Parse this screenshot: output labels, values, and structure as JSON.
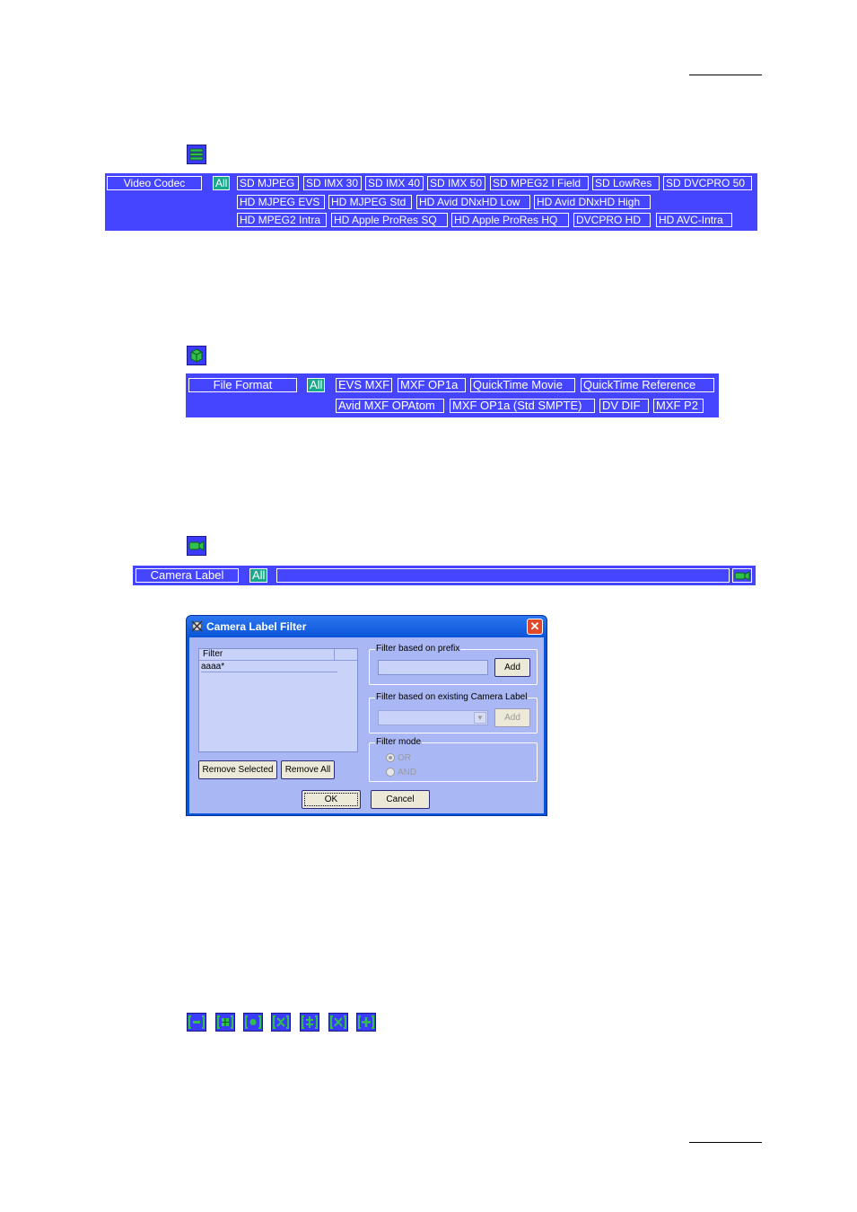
{
  "video_codec": {
    "label": "Video Codec",
    "options": [
      "All",
      "SD MJPEG",
      "SD IMX 30",
      "SD IMX 40",
      "SD IMX 50",
      "SD MPEG2 I Field",
      "SD LowRes",
      "SD DVCPRO 50",
      "HD MJPEG EVS",
      "HD MJPEG Std",
      "HD Avid DNxHD Low",
      "HD Avid DNxHD High",
      "HD MPEG2 Intra",
      "HD Apple ProRes SQ",
      "HD Apple ProRes HQ",
      "DVCPRO HD",
      "HD AVC-Intra"
    ]
  },
  "file_format": {
    "label": "File Format",
    "options": [
      "All",
      "EVS MXF",
      "MXF OP1a",
      "QuickTime Movie",
      "QuickTime Reference",
      "Avid MXF OPAtom",
      "MXF OP1a (Std SMPTE)",
      "DV DIF",
      "MXF P2"
    ]
  },
  "camera_label": {
    "label": "Camera Label",
    "all": "All",
    "field_value": ""
  },
  "dialog": {
    "title": "Camera Label Filter",
    "close": "✕",
    "list_header": "Filter",
    "list_items": [
      "aaaa*"
    ],
    "remove_selected": "Remove Selected",
    "remove_all": "Remove All",
    "prefix_group": "Filter based on prefix",
    "prefix_value": "",
    "add": "Add",
    "existing_group": "Filter based on existing Camera Label",
    "existing_value": "",
    "add_disabled": "Add",
    "mode_group": "Filter mode",
    "mode_or": "OR",
    "mode_and": "AND",
    "ok": "OK",
    "cancel": "Cancel"
  },
  "colors": {
    "bar": "#4545ff",
    "all_chip": "#1aa98a",
    "dialog_client": "#a9b7f5",
    "titlebar": "#0a54d8"
  }
}
